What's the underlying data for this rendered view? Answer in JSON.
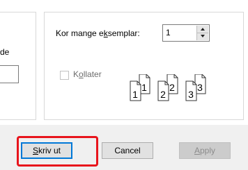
{
  "left_group": {
    "cut_label": "de"
  },
  "copies": {
    "label_before": "Kor mange e",
    "label_mnemonic": "k",
    "label_after": "semplar:",
    "value": "1"
  },
  "collate": {
    "label_mnemonic": "o",
    "label_before": "K",
    "label_after": "llater",
    "checked": false,
    "pages": [
      "1",
      "1",
      "2",
      "2",
      "3",
      "3"
    ]
  },
  "buttons": {
    "print": {
      "label_mnemonic": "S",
      "label_after": "kriv ut"
    },
    "cancel": "Cancel",
    "apply": {
      "label_mnemonic": "A",
      "label_after": "pply"
    }
  },
  "colors": {
    "highlight": "#e8141c",
    "focus_border": "#0078d7",
    "dialog_bg": "#f0f0f0"
  }
}
